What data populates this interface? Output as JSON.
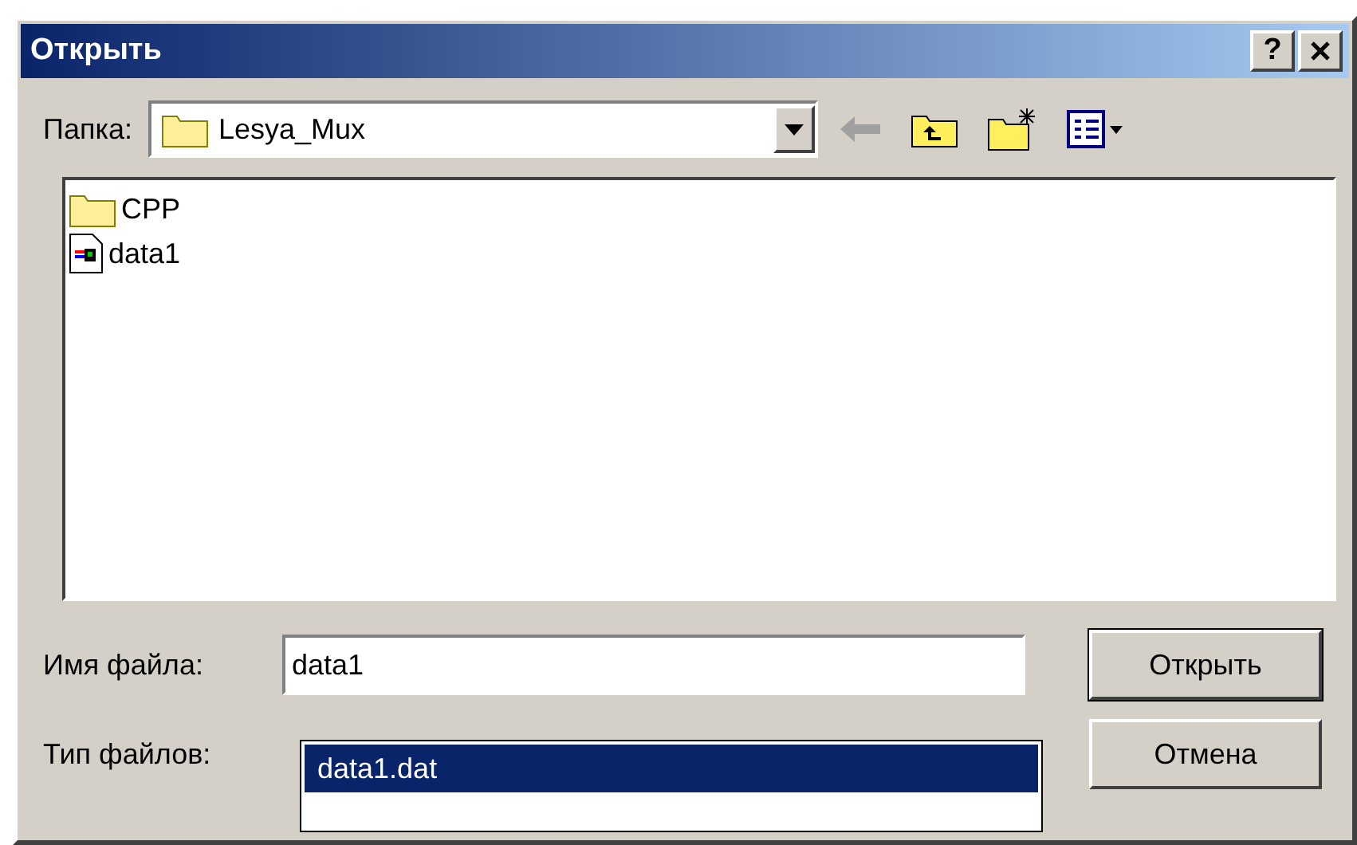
{
  "window": {
    "title": "Открыть",
    "help": "?"
  },
  "folder_bar": {
    "label": "Папка:",
    "value": "Lesya_Mux"
  },
  "files": [
    {
      "name": "CPP",
      "kind": "folder"
    },
    {
      "name": "data1",
      "kind": "data-file"
    }
  ],
  "file_name": {
    "label": "Имя файла:",
    "value": "data1"
  },
  "suggestions": [
    {
      "text": "data1.dat",
      "selected": true
    }
  ],
  "file_type": {
    "label": "Тип файлов:"
  },
  "buttons": [
    {
      "label": "Открыть",
      "default": true
    },
    {
      "label": "Отмена",
      "default": false
    }
  ]
}
